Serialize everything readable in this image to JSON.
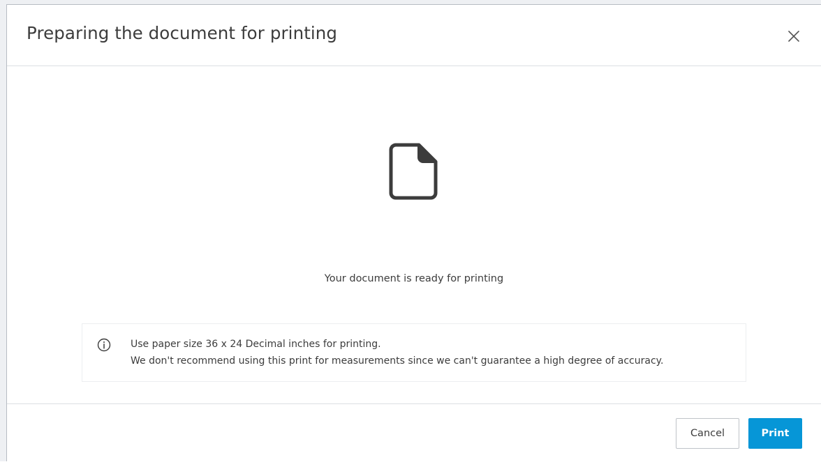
{
  "dialog": {
    "title": "Preparing the document for printing",
    "status_text": "Your document is ready for printing",
    "info": {
      "line1": "Use paper size 36 x 24 Decimal inches for printing.",
      "line2": "We don't recommend using this print for measurements since we can't guarantee a high degree of accuracy."
    },
    "buttons": {
      "cancel_label": "Cancel",
      "print_label": "Print"
    },
    "icons": {
      "close": "close-icon",
      "document": "document-icon",
      "info": "info-icon"
    },
    "colors": {
      "primary": "#0696d7",
      "text": "#3c3c3c",
      "icon": "#3c3c3c"
    }
  }
}
